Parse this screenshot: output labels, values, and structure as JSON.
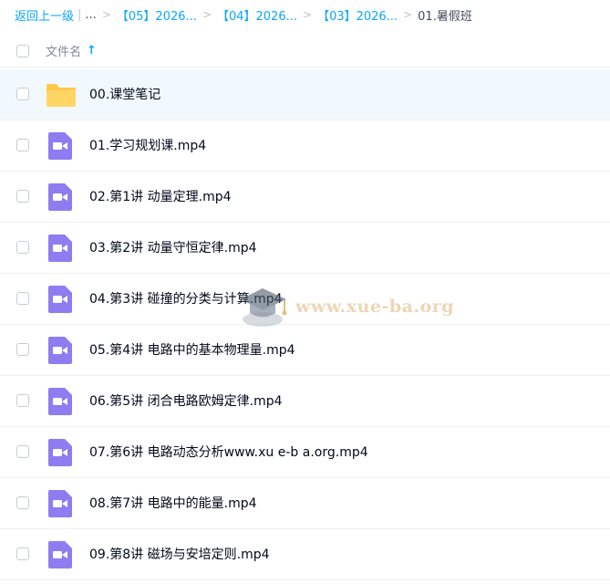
{
  "breadcrumb": {
    "back": "返回上一级",
    "ellipsis": "...",
    "items": [
      "【05】2026...",
      "【04】2026...",
      "【03】2026..."
    ],
    "current": "01.暑假班"
  },
  "header": {
    "name_label": "文件名",
    "sort_arrow": "↑"
  },
  "files": [
    {
      "name": "00.课堂笔记",
      "type": "folder"
    },
    {
      "name": "01.学习规划课.mp4",
      "type": "video"
    },
    {
      "name": "02.第1讲 动量定理.mp4",
      "type": "video"
    },
    {
      "name": "03.第2讲 动量守恒定律.mp4",
      "type": "video"
    },
    {
      "name": "04.第3讲 碰撞的分类与计算.mp4",
      "type": "video"
    },
    {
      "name": "05.第4讲 电路中的基本物理量.mp4",
      "type": "video"
    },
    {
      "name": "06.第5讲 闭合电路欧姆定律.mp4",
      "type": "video"
    },
    {
      "name": "07.第6讲 电路动态分析www.xu e-b a.org.mp4",
      "type": "video"
    },
    {
      "name": "08.第7讲 电路中的能量.mp4",
      "type": "video"
    },
    {
      "name": "09.第8讲 磁场与安培定则.mp4",
      "type": "video"
    }
  ],
  "watermark": {
    "text": "www.xue-ba.org"
  },
  "colors": {
    "accent": "#06a7ff",
    "folder": "#ffc94d",
    "video": "#8e7cf0",
    "row_highlight": "#f2f9fe"
  }
}
